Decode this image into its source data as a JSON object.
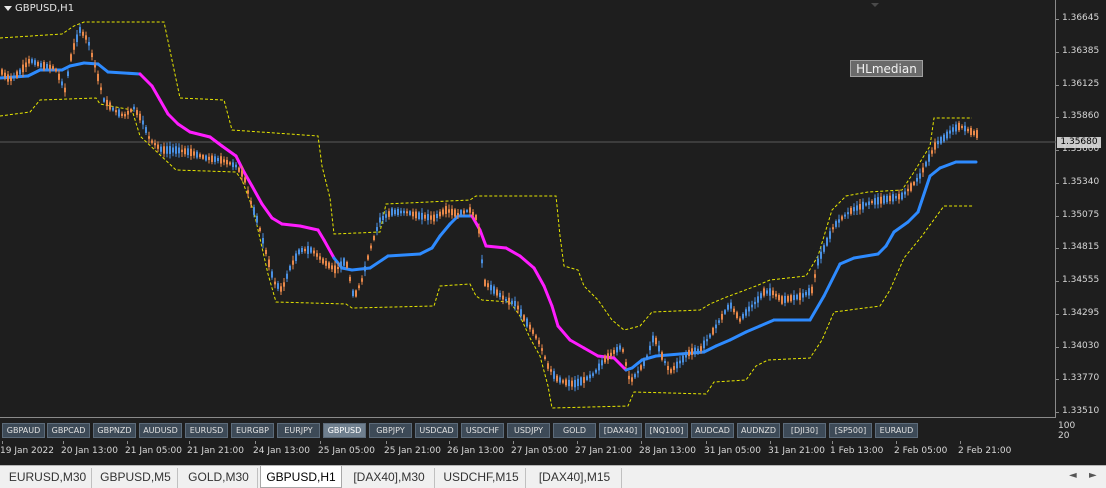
{
  "chart": {
    "title": "GBPUSD,H1",
    "indicator_button_label": "HLmedian",
    "current_price": "1.35680",
    "price_levels": [
      "1.36645",
      "1.36385",
      "1.36125",
      "1.35860",
      "1.35600",
      "1.35340",
      "1.35075",
      "1.34815",
      "1.34555",
      "1.34295",
      "1.34030",
      "1.33770",
      "1.33510"
    ],
    "indicator_scale": [
      "100",
      "20"
    ],
    "time_labels": [
      "19 Jan 2022",
      "20 Jan 13:00",
      "21 Jan 05:00",
      "21 Jan 21:00",
      "24 Jan 13:00",
      "25 Jan 05:00",
      "25 Jan 21:00",
      "26 Jan 13:00",
      "27 Jan 05:00",
      "27 Jan 21:00",
      "28 Jan 13:00",
      "31 Jan 05:00",
      "31 Jan 21:00",
      "1 Feb 13:00",
      "2 Feb 05:00",
      "2 Feb 21:00"
    ],
    "colors": {
      "median_up": "#2e8bff",
      "median_down": "#ff1cff",
      "channel": "#e6e600",
      "candle_up": "#4a90e2",
      "candle_down": "#e8884a"
    }
  },
  "symbol_buttons": [
    {
      "label": "GBPAUD",
      "active": false
    },
    {
      "label": "GBPCAD",
      "active": false
    },
    {
      "label": "GBPNZD",
      "active": false
    },
    {
      "label": "AUDUSD",
      "active": false
    },
    {
      "label": "EURUSD",
      "active": false
    },
    {
      "label": "EURGBP",
      "active": false
    },
    {
      "label": "EURJPY",
      "active": false
    },
    {
      "label": "GBPUSD",
      "active": true
    },
    {
      "label": "GBPJPY",
      "active": false
    },
    {
      "label": "USDCAD",
      "active": false
    },
    {
      "label": "USDCHF",
      "active": false
    },
    {
      "label": "USDJPY",
      "active": false
    },
    {
      "label": "GOLD",
      "active": false
    },
    {
      "label": "[DAX40]",
      "active": false
    },
    {
      "label": "[NQ100]",
      "active": false
    },
    {
      "label": "AUDCAD",
      "active": false
    },
    {
      "label": "AUDNZD",
      "active": false
    },
    {
      "label": "[DJI30]",
      "active": false
    },
    {
      "label": "[SP500]",
      "active": false
    },
    {
      "label": "EURAUD",
      "active": false
    }
  ],
  "tabs": [
    {
      "label": "EURUSD,M30",
      "active": false
    },
    {
      "label": "GBPUSD,M5",
      "active": false
    },
    {
      "label": "GOLD,M30",
      "active": false
    },
    {
      "label": "GBPUSD,H1",
      "active": true
    },
    {
      "label": "[DAX40],M30",
      "active": false
    },
    {
      "label": "USDCHF,M15",
      "active": false
    },
    {
      "label": "[DAX40],M15",
      "active": false
    }
  ]
}
